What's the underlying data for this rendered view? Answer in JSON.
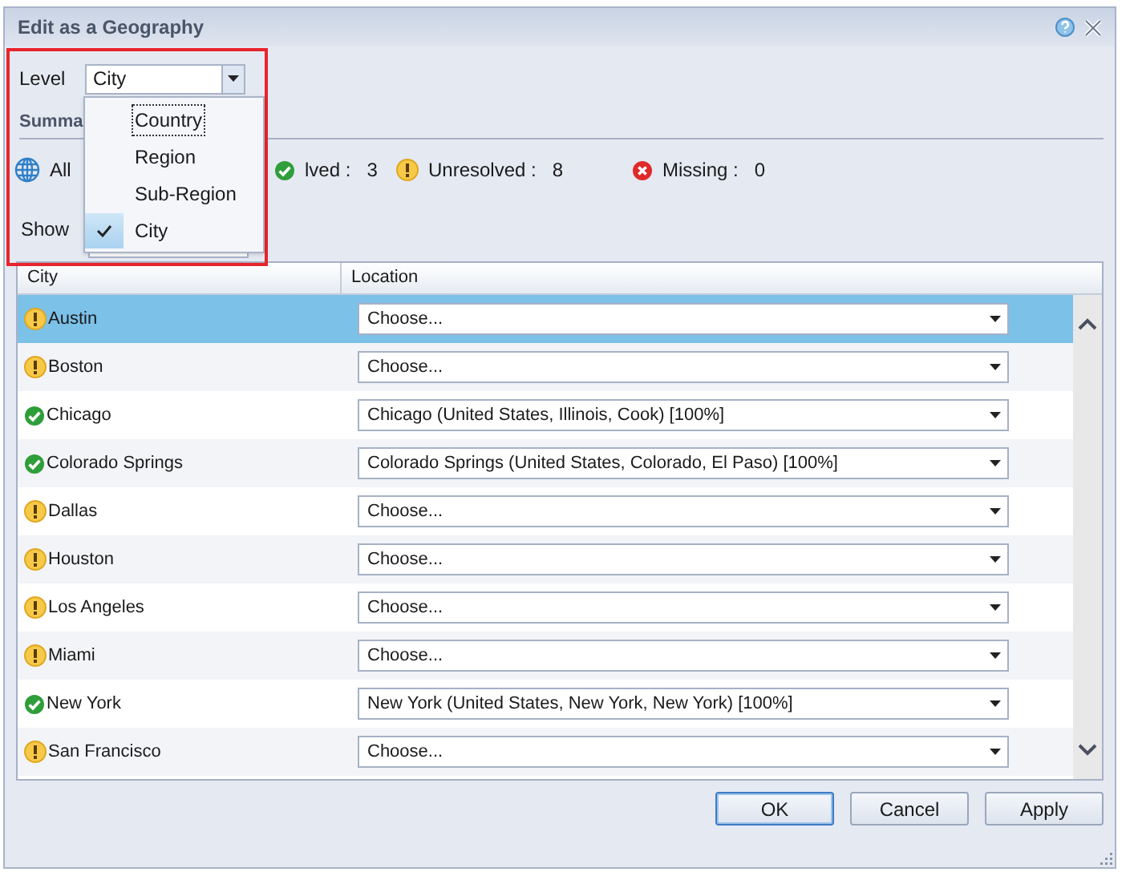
{
  "window": {
    "title": "Edit as a Geography"
  },
  "level": {
    "label": "Level",
    "value": "City",
    "open": true,
    "options": [
      {
        "label": "Country",
        "selected": false,
        "focused": true
      },
      {
        "label": "Region",
        "selected": false,
        "focused": false
      },
      {
        "label": "Sub-Region",
        "selected": false,
        "focused": false
      },
      {
        "label": "City",
        "selected": true,
        "focused": false
      }
    ]
  },
  "summary": {
    "heading": "Summa",
    "stats": [
      {
        "kind": "all",
        "label": "All"
      },
      {
        "kind": "resolved",
        "label": "lved :",
        "value": "3"
      },
      {
        "kind": "unresolved",
        "label": "Unresolved :",
        "value": "8"
      },
      {
        "kind": "missing",
        "label": "Missing :",
        "value": "0"
      }
    ]
  },
  "show": {
    "label": "Show"
  },
  "table": {
    "columns": [
      "City",
      "Location"
    ],
    "rows": [
      {
        "city": "Austin",
        "kind": "unresolved",
        "location": "Choose...",
        "selected": true
      },
      {
        "city": "Boston",
        "kind": "unresolved",
        "location": "Choose...",
        "selected": false
      },
      {
        "city": "Chicago",
        "kind": "resolved",
        "location": "Chicago (United States, Illinois, Cook) [100%]",
        "selected": false
      },
      {
        "city": "Colorado Springs",
        "kind": "resolved",
        "location": "Colorado Springs (United States, Colorado, El Paso) [100%]",
        "selected": false
      },
      {
        "city": "Dallas",
        "kind": "unresolved",
        "location": "Choose...",
        "selected": false
      },
      {
        "city": "Houston",
        "kind": "unresolved",
        "location": "Choose...",
        "selected": false
      },
      {
        "city": "Los Angeles",
        "kind": "unresolved",
        "location": "Choose...",
        "selected": false
      },
      {
        "city": "Miami",
        "kind": "unresolved",
        "location": "Choose...",
        "selected": false
      },
      {
        "city": "New York",
        "kind": "resolved",
        "location": "New York (United States, New York, New York) [100%]",
        "selected": false
      },
      {
        "city": "San Francisco",
        "kind": "unresolved",
        "location": "Choose...",
        "selected": false
      }
    ]
  },
  "buttons": [
    {
      "label": "OK",
      "default": true
    },
    {
      "label": "Cancel",
      "default": false
    },
    {
      "label": "Apply",
      "default": false
    }
  ]
}
